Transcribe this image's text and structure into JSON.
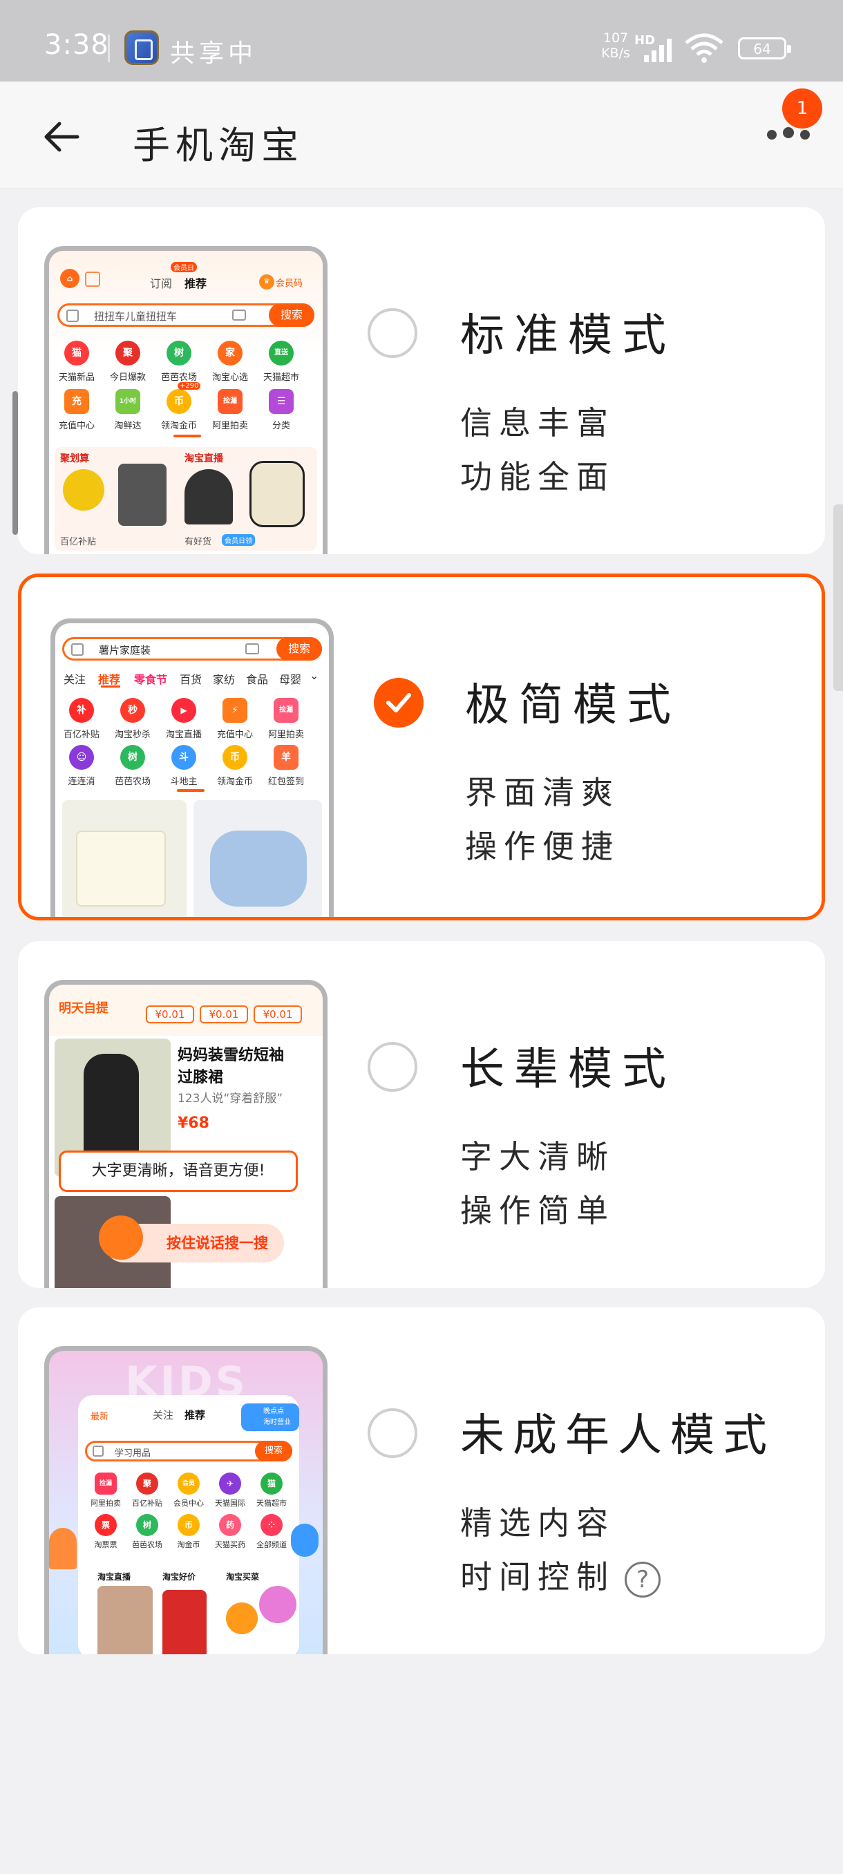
{
  "status_bar": {
    "time": "3:38",
    "sharing_text": "共享中",
    "net_speed_value": "107",
    "net_speed_unit": "KB/s",
    "hd_label": "HD",
    "battery": "64"
  },
  "header": {
    "title": "手机淘宝",
    "badge_count": "1"
  },
  "colors": {
    "accent": "#ff5500",
    "background": "#f1f0f2",
    "card": "#ffffff"
  },
  "modes": [
    {
      "name": "标准模式",
      "desc1": "信息丰富",
      "desc2": "功能全面",
      "selected": false,
      "preview": {
        "tabs": [
          "订阅",
          "推荐"
        ],
        "tab_badge": "会员日",
        "vip_label": "会员码",
        "search_placeholder": "扭扭车儿童扭扭车",
        "search_button": "搜索",
        "icons": [
          "天猫新品",
          "今日爆款",
          "芭芭农场",
          "淘宝心选",
          "天猫超市",
          "充值中心",
          "淘鲜达",
          "领淘金币",
          "阿里拍卖",
          "分类"
        ],
        "icon_glyphs": [
          "猫",
          "聚",
          "树",
          "家",
          "直送",
          "充",
          "1小时",
          "币",
          "捡漏",
          "☰"
        ],
        "coin_badge": "+290",
        "section_left": "聚划算",
        "section_left_sub": "百亿补贴",
        "section_right": "淘宝直播",
        "section_right_sub": "有好货",
        "section_right_badge": "会员日领"
      }
    },
    {
      "name": "极简模式",
      "desc1": "界面清爽",
      "desc2": "操作便捷",
      "selected": true,
      "preview": {
        "search_placeholder": "薯片家庭装",
        "search_button": "搜索",
        "tabs": [
          "关注",
          "推荐",
          "零食节",
          "百货",
          "家纺",
          "食品",
          "母婴"
        ],
        "icons": [
          "百亿补贴",
          "淘宝秒杀",
          "淘宝直播",
          "充值中心",
          "阿里拍卖",
          "连连消",
          "芭芭农场",
          "斗地主",
          "领淘金币",
          "红包签到"
        ],
        "icon_glyphs": [
          "补",
          "秒",
          "▶",
          "⚡",
          "捡漏",
          "☺",
          "树",
          "斗",
          "币",
          "羊"
        ]
      }
    },
    {
      "name": "长辈模式",
      "desc1": "字大清晰",
      "desc2": "操作简单",
      "selected": false,
      "preview": {
        "header_label": "明天自提",
        "prices": [
          "¥0.01",
          "¥0.01",
          "¥0.01"
        ],
        "product_title_1": "妈妈装雪纺短袖",
        "product_title_2": "过膝裙",
        "product_sub": "123人说“穿着舒服”",
        "product_price": "¥68",
        "tip_text": "大字更清晰，语音更方便!",
        "voice_button": "按住说话搜一搜"
      }
    },
    {
      "name": "未成年人模式",
      "desc1": "精选内容",
      "desc2": "时间控制",
      "help_icon": "?",
      "selected": false,
      "preview": {
        "bg_text": "KIDS",
        "left_tag": "最新",
        "tabs": [
          "关注",
          "推荐"
        ],
        "corner_text_1": "晚点点",
        "corner_text_2": "海时营业",
        "search_placeholder": "学习用品",
        "search_button": "搜索",
        "icons": [
          "阿里拍卖",
          "百亿补贴",
          "会员中心",
          "天猫国际",
          "天猫超市",
          "淘票票",
          "芭芭农场",
          "淘金币",
          "天猫买药",
          "全部频道"
        ],
        "icon_glyphs": [
          "捡漏",
          "聚",
          "会员",
          "✈",
          "猫",
          "票",
          "树",
          "币",
          "药",
          "⁘"
        ],
        "section_1": "淘宝直播",
        "section_2": "淘宝好价",
        "section_3": "淘宝买菜"
      }
    }
  ]
}
